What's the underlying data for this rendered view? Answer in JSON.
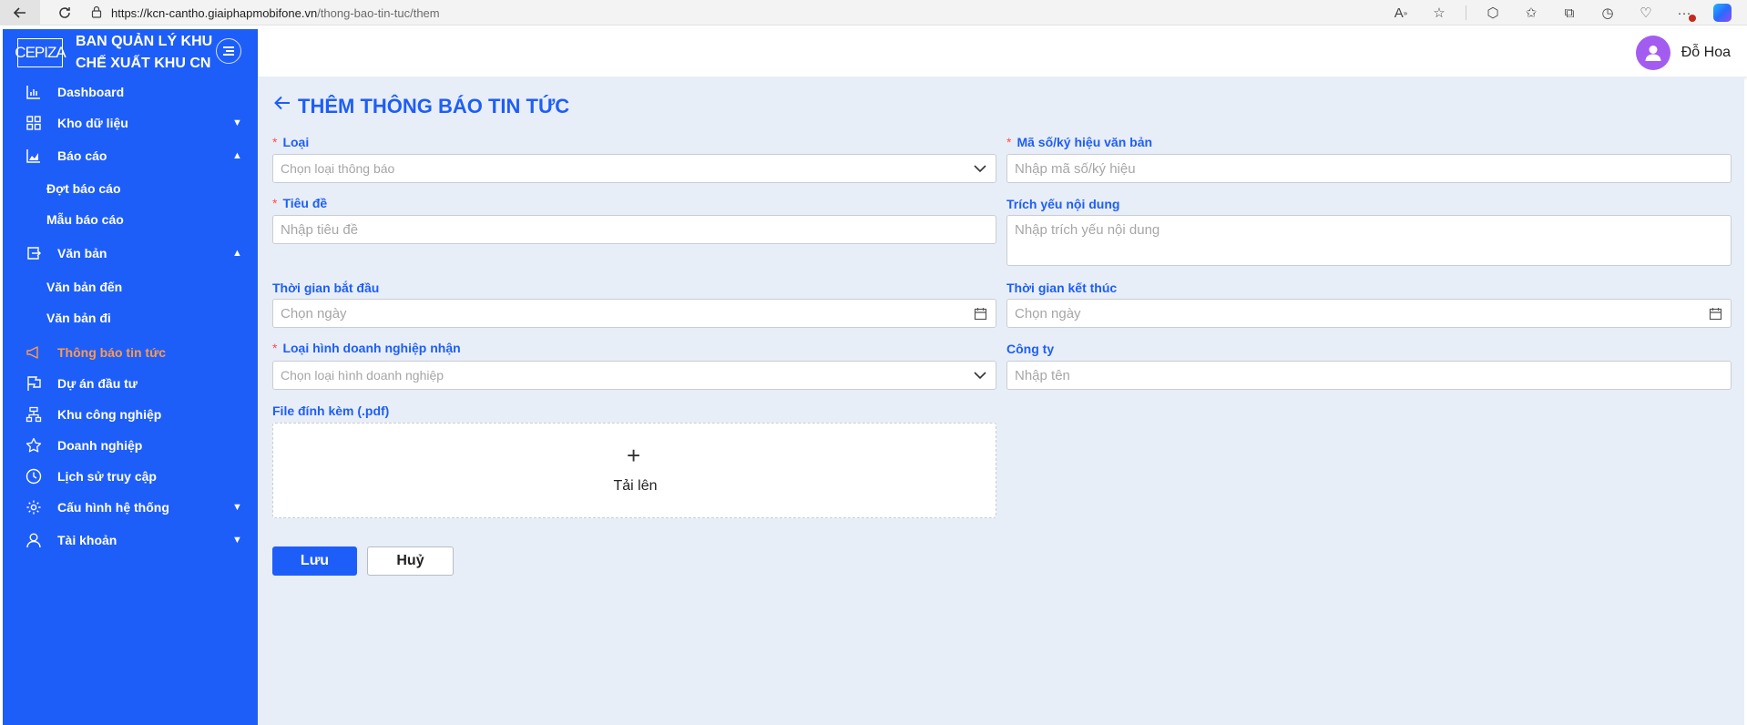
{
  "browser": {
    "url_host": "https://kcn-cantho.giaiphapmobifone.vn",
    "url_path": "/thong-bao-tin-tuc/them"
  },
  "brand": {
    "logo_text": "CEPIZA",
    "title_line1": "BAN QUẢN LÝ KHU",
    "title_line2": "CHẾ XUẤT KHU CN"
  },
  "sidebar": {
    "items": [
      {
        "label": "Dashboard",
        "icon": "chart-bar-icon"
      },
      {
        "label": "Kho dữ liệu",
        "icon": "grid-icon",
        "expandable": true
      },
      {
        "label": "Báo cáo",
        "icon": "area-chart-icon",
        "expanded": true
      },
      {
        "label": "Đợt báo cáo"
      },
      {
        "label": "Mẫu báo cáo"
      },
      {
        "label": "Văn bản",
        "icon": "document-export-icon",
        "expanded": true
      },
      {
        "label": "Văn bản đến"
      },
      {
        "label": "Văn bản đi"
      },
      {
        "label": "Thông báo tin tức",
        "icon": "megaphone-icon",
        "active": true
      },
      {
        "label": "Dự án đầu tư",
        "icon": "flag-icon"
      },
      {
        "label": "Khu công nghiệp",
        "icon": "cluster-icon"
      },
      {
        "label": "Doanh nghiệp",
        "icon": "star-icon"
      },
      {
        "label": "Lịch sử truy cập",
        "icon": "clock-icon"
      },
      {
        "label": "Cấu hình hệ thống",
        "icon": "gear-icon",
        "expandable": true
      },
      {
        "label": "Tài khoản",
        "icon": "user-icon",
        "expandable": true
      }
    ]
  },
  "header": {
    "username": "Đỗ Hoa"
  },
  "page": {
    "title": "THÊM THÔNG BÁO TIN TỨC"
  },
  "form": {
    "loai": {
      "label": "Loại",
      "placeholder": "Chọn loại thông báo",
      "required": true
    },
    "ma_so": {
      "label": "Mã số/ký hiệu văn bản",
      "placeholder": "Nhập mã số/ký hiệu",
      "required": true
    },
    "tieu_de": {
      "label": "Tiêu đề",
      "placeholder": "Nhập tiêu đề",
      "required": true
    },
    "trich_yeu": {
      "label": "Trích yếu nội dung",
      "placeholder": "Nhập trích yếu nội dung"
    },
    "bat_dau": {
      "label": "Thời gian bắt đầu",
      "placeholder": "Chọn ngày"
    },
    "ket_thuc": {
      "label": "Thời gian kết thúc",
      "placeholder": "Chọn ngày"
    },
    "loai_hinh": {
      "label": "Loại hình doanh nghiệp nhận",
      "placeholder": "Chọn loại hình doanh nghiệp",
      "required": true
    },
    "cong_ty": {
      "label": "Công ty",
      "placeholder": "Nhập tên"
    },
    "file": {
      "label": "File đính kèm (.pdf)",
      "upload_label": "Tải lên"
    }
  },
  "actions": {
    "save_label": "Lưu",
    "cancel_label": "Huỷ"
  },
  "colors": {
    "primary": "#1e5ef8",
    "active_nav": "#ff9a4d",
    "required": "#ff4d4f",
    "content_bg": "#e8eef7",
    "avatar": "#a35cf0"
  }
}
